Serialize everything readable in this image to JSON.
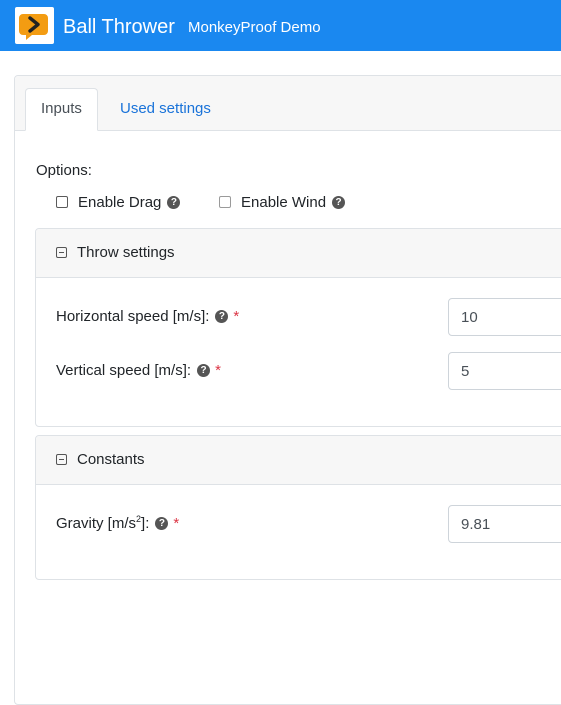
{
  "header": {
    "app_title": "Ball Thrower",
    "subtitle": "MonkeyProof Demo",
    "accent_color": "#1a88f0",
    "logo_icon": "chevron-speech-bubble-icon"
  },
  "tabs": [
    {
      "label": "Inputs",
      "active": true
    },
    {
      "label": "Used settings",
      "active": false
    }
  ],
  "options": {
    "label": "Options:",
    "items": [
      {
        "label": "Enable Drag",
        "checked": false
      },
      {
        "label": "Enable Wind",
        "checked": false
      }
    ]
  },
  "panels": {
    "throw": {
      "title": "Throw settings",
      "fields": [
        {
          "label": "Horizontal speed [m/s]:",
          "value": "10",
          "required": "*"
        },
        {
          "label": "Vertical speed [m/s]:",
          "value": "5",
          "required": "*"
        }
      ]
    },
    "constants": {
      "title": "Constants",
      "gravity": {
        "label_pre": "Gravity [m/s",
        "label_sup": "2",
        "label_post": "]:",
        "value": "9.81",
        "required": "*"
      }
    }
  }
}
